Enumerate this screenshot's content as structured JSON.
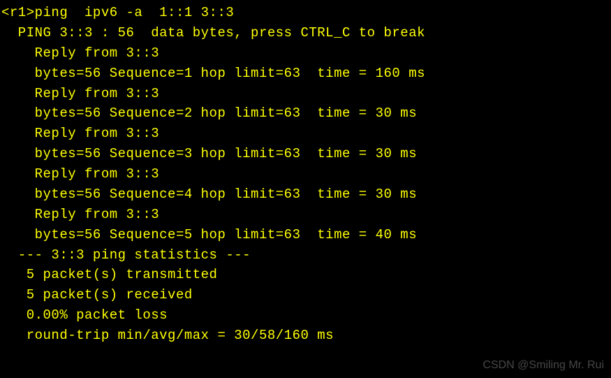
{
  "prompt": {
    "hostname": "<r1>",
    "command": "ping  ipv6 -a  1::1 3::3"
  },
  "header": "  PING 3::3 : 56  data bytes, press CTRL_C to break",
  "replies": [
    {
      "from_line": "    Reply from 3::3",
      "stats_line": "    bytes=56 Sequence=1 hop limit=63  time = 160 ms"
    },
    {
      "from_line": "    Reply from 3::3",
      "stats_line": "    bytes=56 Sequence=2 hop limit=63  time = 30 ms"
    },
    {
      "from_line": "    Reply from 3::3",
      "stats_line": "    bytes=56 Sequence=3 hop limit=63  time = 30 ms"
    },
    {
      "from_line": "    Reply from 3::3",
      "stats_line": "    bytes=56 Sequence=4 hop limit=63  time = 30 ms"
    },
    {
      "from_line": "    Reply from 3::3",
      "stats_line": "    bytes=56 Sequence=5 hop limit=63  time = 40 ms"
    }
  ],
  "blank_line": "",
  "stats": {
    "header": "  --- 3::3 ping statistics ---",
    "transmitted": "   5 packet(s) transmitted",
    "received": "   5 packet(s) received",
    "loss": "   0.00% packet loss",
    "rtt": "   round-trip min/avg/max = 30/58/160 ms"
  },
  "watermark": "CSDN @Smiling Mr. Rui"
}
